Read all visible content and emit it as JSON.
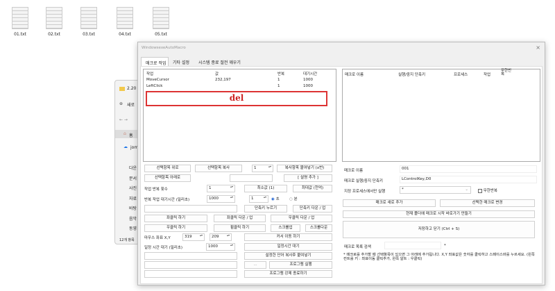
{
  "desktop": {
    "files": [
      "01.txt",
      "02.txt",
      "03.txt",
      "04.txt",
      "05.txt"
    ]
  },
  "explorer": {
    "title": "2.20",
    "new": "새로",
    "home": "홈",
    "cloud": "jom",
    "nav": [
      "다운",
      "문서",
      "사진",
      "자료",
      "바탕",
      "음악",
      "동영"
    ],
    "count": "12개 항목"
  },
  "window": {
    "title": "WindowsexeAutoMacro",
    "close": "×",
    "tabs": [
      "매크로 작업",
      "기타 설정",
      "시스템 종료 절전 깨우기"
    ],
    "task_list": {
      "columns": [
        "작업",
        "값",
        "반복",
        "대기시간"
      ],
      "rows": [
        [
          "MoveCursor",
          "232,197",
          "1",
          "1000"
        ],
        [
          "LeftClick",
          "1",
          "1000"
        ]
      ],
      "annotation": "del"
    },
    "left": {
      "move_up": "선택항목 위로",
      "copy": "선택항목 복사",
      "copy_count": "1",
      "paste": "복사항목 붙여넣기 (x번)",
      "move_down": "선택항목 아래로",
      "add_desc": "[ 설명 추가 ]",
      "repeat_label": "작업 반복 횟수",
      "repeat_value": "1",
      "min": "최소값 (1)",
      "max": "최대값 (천억)",
      "wait_label": "반복 작업 대기시간 (밀리초)",
      "wait_value": "1000",
      "unit_value": "1",
      "sec": "초",
      "min_unit": "분",
      "press_key": "단축키 누르기",
      "key_down_up": "단축키 다운 / 업",
      "left_click": "좌클릭 하기",
      "left_down_up": "좌클릭 다운 / 업",
      "right_down_up": "우클릭 다운 / 업",
      "right_click": "우클릭 하기",
      "wheel_click": "휠클릭 하기",
      "scroll_up": "스크롤업",
      "scroll_down": "스크롤다운",
      "coord_label": "마우스 좌표 X,Y",
      "x": "319",
      "y": "209",
      "move_cursor": "커서 이동 하기",
      "delay_label": "일정 시간 대기 (밀리초)",
      "delay_value": "1000",
      "delay_btn": "일정시간 대기",
      "paste_word": "설정한 단어 복사후 붙여넣기",
      "browse": "...",
      "run_program": "프로그램 실행",
      "kill_program": "프로그램 강제 종료하기"
    },
    "macro_list": {
      "columns": [
        "매크로 이름",
        "실행/중지 단축키",
        "프로세스",
        "작업",
        "무한반복"
      ]
    },
    "right": {
      "name_label": "매크로 이름",
      "name_value": "001",
      "hotkey_label": "매크로 실행/중지 단축키",
      "hotkey_value": "LControlKey,D0",
      "process_label": "지정 프로세스에서만 실행",
      "process_value": "*",
      "infinite": "무한반복",
      "add_macro": "매크로 새로 추가",
      "change_macro": "선택한 매크로 변경",
      "shortcut": "현재 폴더에 매크로 시작 바로가기 만들기",
      "save": "저장하고 닫기 (Ctrl + S)",
      "search_label": "매크로 목록 검색",
      "search_suffix": "*",
      "note": "* 매크로를 추가할 때 선택항목이 있으면 그 아래에 추가됩니다. X,Y 좌표값은 숫자를 클릭하고 스페이스바를 누르세요. (왼쪽 컨트롤 키 : 좌표이동 클릭추가, 왼쪽 알트 : 우클릭)"
    }
  }
}
